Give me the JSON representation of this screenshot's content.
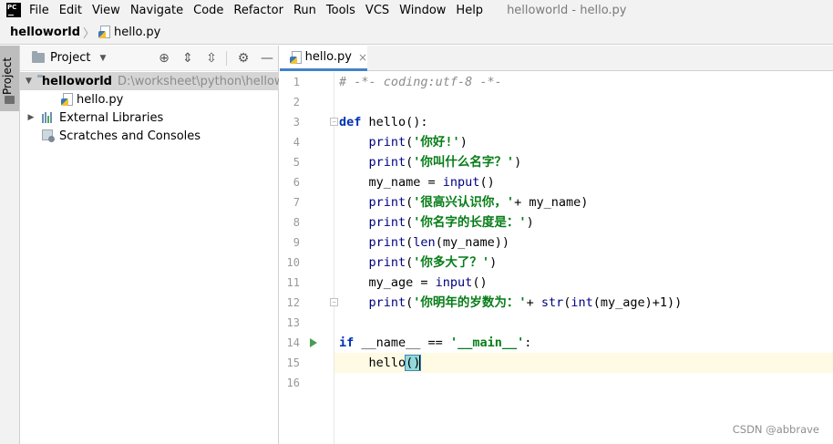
{
  "menubar": {
    "app_logo": "PC",
    "items": [
      "File",
      "Edit",
      "View",
      "Navigate",
      "Code",
      "Refactor",
      "Run",
      "Tools",
      "VCS",
      "Window",
      "Help"
    ],
    "window_title": "helloworld - hello.py"
  },
  "navbar": {
    "project": "helloworld",
    "separator": "〉",
    "file": "hello.py"
  },
  "side_stripe": {
    "tab_label": "Project"
  },
  "project_panel": {
    "title": "Project",
    "tools": [
      "locate-icon",
      "expand-all-icon",
      "collapse-all-icon",
      "gear-icon",
      "hide-icon"
    ],
    "tree": {
      "root_name": "helloworld",
      "root_path": "D:\\worksheet\\python\\hellowo",
      "child_file": "hello.py",
      "external_libraries": "External Libraries",
      "scratches": "Scratches and Consoles"
    }
  },
  "editor": {
    "tab_label": "hello.py",
    "tab_close": "×",
    "line_numbers": [
      "1",
      "2",
      "3",
      "4",
      "5",
      "6",
      "7",
      "8",
      "9",
      "10",
      "11",
      "12",
      "13",
      "14",
      "15",
      "16"
    ],
    "lines": [
      [
        {
          "t": "# -*- coding:utf-8 -*-",
          "c": "comment"
        }
      ],
      [],
      [
        {
          "t": "def",
          "c": "kw"
        },
        {
          "t": " hello():",
          "c": "plain"
        }
      ],
      [
        {
          "t": "    ",
          "c": "plain"
        },
        {
          "t": "print",
          "c": "builtin"
        },
        {
          "t": "(",
          "c": "plain"
        },
        {
          "t": "'你好!'",
          "c": "str"
        },
        {
          "t": ")",
          "c": "plain"
        }
      ],
      [
        {
          "t": "    ",
          "c": "plain"
        },
        {
          "t": "print",
          "c": "builtin"
        },
        {
          "t": "(",
          "c": "plain"
        },
        {
          "t": "'你叫什么名字？'",
          "c": "str"
        },
        {
          "t": ")",
          "c": "plain"
        }
      ],
      [
        {
          "t": "    my_name = ",
          "c": "plain"
        },
        {
          "t": "input",
          "c": "builtin"
        },
        {
          "t": "()",
          "c": "plain"
        }
      ],
      [
        {
          "t": "    ",
          "c": "plain"
        },
        {
          "t": "print",
          "c": "builtin"
        },
        {
          "t": "(",
          "c": "plain"
        },
        {
          "t": "'很高兴认识你，'",
          "c": "str"
        },
        {
          "t": "+ my_name)",
          "c": "plain"
        }
      ],
      [
        {
          "t": "    ",
          "c": "plain"
        },
        {
          "t": "print",
          "c": "builtin"
        },
        {
          "t": "(",
          "c": "plain"
        },
        {
          "t": "'你名字的长度是：'",
          "c": "str"
        },
        {
          "t": ")",
          "c": "plain"
        }
      ],
      [
        {
          "t": "    ",
          "c": "plain"
        },
        {
          "t": "print",
          "c": "builtin"
        },
        {
          "t": "(",
          "c": "plain"
        },
        {
          "t": "len",
          "c": "builtin"
        },
        {
          "t": "(my_name))",
          "c": "plain"
        }
      ],
      [
        {
          "t": "    ",
          "c": "plain"
        },
        {
          "t": "print",
          "c": "builtin"
        },
        {
          "t": "(",
          "c": "plain"
        },
        {
          "t": "'你多大了？'",
          "c": "str"
        },
        {
          "t": ")",
          "c": "plain"
        }
      ],
      [
        {
          "t": "    my_age = ",
          "c": "plain"
        },
        {
          "t": "input",
          "c": "builtin"
        },
        {
          "t": "()",
          "c": "plain"
        }
      ],
      [
        {
          "t": "    ",
          "c": "plain"
        },
        {
          "t": "print",
          "c": "builtin"
        },
        {
          "t": "(",
          "c": "plain"
        },
        {
          "t": "'你明年的岁数为：'",
          "c": "str"
        },
        {
          "t": "+ ",
          "c": "plain"
        },
        {
          "t": "str",
          "c": "builtin"
        },
        {
          "t": "(",
          "c": "plain"
        },
        {
          "t": "int",
          "c": "builtin"
        },
        {
          "t": "(my_age)+1))",
          "c": "plain"
        }
      ],
      [],
      [
        {
          "t": "if",
          "c": "kw"
        },
        {
          "t": " __name__ == ",
          "c": "plain"
        },
        {
          "t": "'__main__'",
          "c": "str"
        },
        {
          "t": ":",
          "c": "plain"
        }
      ],
      [
        {
          "t": "    hello",
          "c": "plain"
        },
        {
          "t": "()",
          "c": "paren-hl"
        }
      ],
      []
    ],
    "current_line_index": 14,
    "run_gutter_line_index": 13,
    "fold_marker_line_indexes": [
      2,
      11
    ]
  },
  "watermark": "CSDN @abbrave",
  "colors": {
    "keyword": "#0033b3",
    "string": "#067d17",
    "comment": "#8c8c8c",
    "builtin": "#000080",
    "current_line": "#fffae3",
    "selection": "#d5d5d5",
    "tab_underline": "#4083c9"
  }
}
